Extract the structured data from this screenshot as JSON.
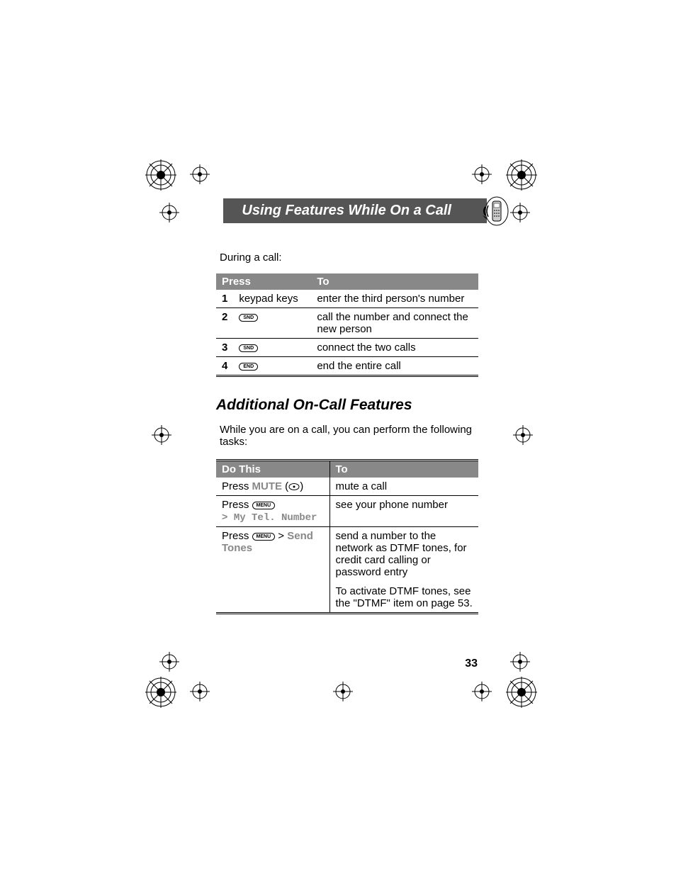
{
  "header": {
    "title": "Using Features While On a Call"
  },
  "intro": "During a call:",
  "table1": {
    "headers": {
      "press": "Press",
      "to": "To"
    },
    "rows": [
      {
        "num": "1",
        "press_text": "keypad keys",
        "key": "",
        "to": "enter the third person's number"
      },
      {
        "num": "2",
        "press_text": "",
        "key": "SND",
        "to": "call the number and connect the new person"
      },
      {
        "num": "3",
        "press_text": "",
        "key": "SND",
        "to": "connect the two calls"
      },
      {
        "num": "4",
        "press_text": "",
        "key": "END",
        "to": "end the entire call"
      }
    ]
  },
  "section_heading": "Additional On-Call Features",
  "subtext": "While you are on a call, you can perform the following tasks:",
  "table2": {
    "headers": {
      "do": "Do This",
      "to": "To"
    },
    "rows": [
      {
        "prefix": "Press ",
        "bold": "MUTE",
        "paren_icon": true,
        "suffix": "",
        "to": "mute a call"
      },
      {
        "prefix": "Press ",
        "key": "MENU",
        "line2_prefix": "> ",
        "line2_mono": "My Tel. Number",
        "to": "see your phone number"
      },
      {
        "prefix": "Press ",
        "key": "MENU",
        "suffix": " > ",
        "bold_suffix": "Send Tones",
        "to": "send a number to the network as DTMF tones, for credit card calling or password entry",
        "to2": "To activate DTMF tones, see the \"DTMF\" item on page 53."
      }
    ]
  },
  "page_number": "33"
}
